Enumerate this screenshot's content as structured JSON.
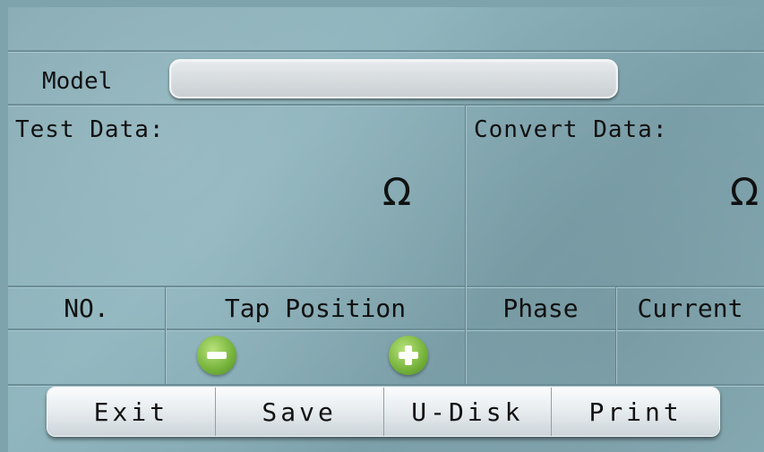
{
  "model": {
    "label": "Model",
    "value": ""
  },
  "test_data": {
    "label": "Test Data:",
    "unit": "Ω"
  },
  "convert_data": {
    "label": "Convert Data:",
    "unit": "Ω"
  },
  "table": {
    "headers": [
      "NO.",
      "Tap Position",
      "Phase",
      "Current"
    ]
  },
  "tap_controls": {
    "decrease_icon": "minus-circle-icon",
    "increase_icon": "plus-circle-icon"
  },
  "toolbar": {
    "exit_label": "Exit",
    "save_label": "Save",
    "udisk_label": "U-Disk",
    "print_label": "Print"
  },
  "colors": {
    "accent_green": "#74b23a",
    "background": "#86aab3"
  }
}
